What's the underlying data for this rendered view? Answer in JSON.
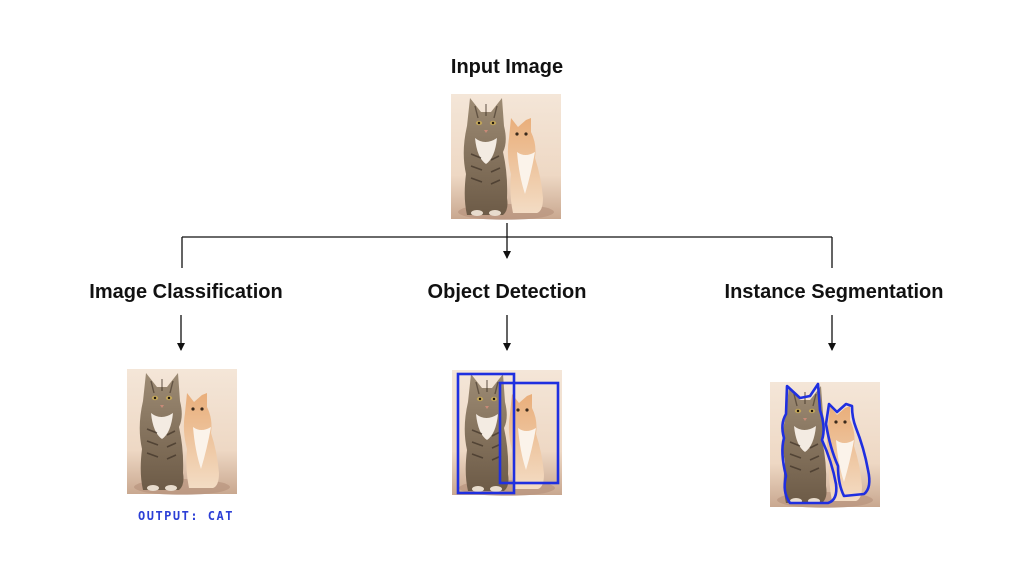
{
  "diagram": {
    "input": {
      "title": "Input Image"
    },
    "tasks": [
      {
        "title": "Image Classification",
        "output": "OUTPUT: CAT"
      },
      {
        "title": "Object Detection"
      },
      {
        "title": "Instance Segmentation"
      }
    ]
  },
  "colors": {
    "annotation_blue": "#1f2fe0",
    "output_text": "#2c3fd6",
    "connector": "#111111"
  }
}
